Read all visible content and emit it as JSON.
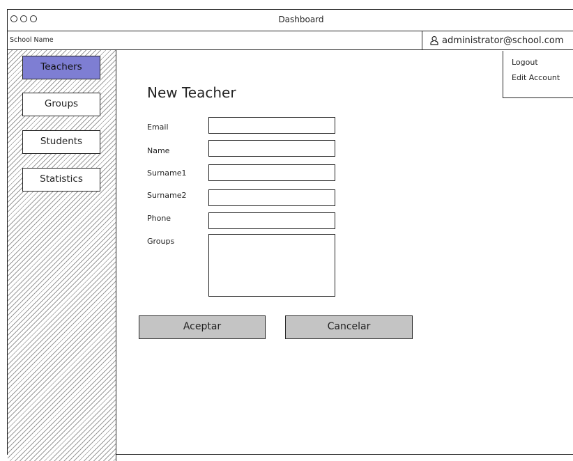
{
  "window": {
    "title": "Dashboard"
  },
  "header": {
    "school_name": "School Name",
    "user_email": "administrator@school.com"
  },
  "user_menu": {
    "items": [
      {
        "label": "Logout"
      },
      {
        "label": "Edit Account"
      }
    ]
  },
  "sidebar": {
    "items": [
      {
        "label": "Teachers",
        "active": true
      },
      {
        "label": "Groups",
        "active": false
      },
      {
        "label": "Students",
        "active": false
      },
      {
        "label": "Statistics",
        "active": false
      }
    ]
  },
  "form": {
    "title": "New Teacher",
    "fields": [
      {
        "label": "Email",
        "value": ""
      },
      {
        "label": "Name",
        "value": ""
      },
      {
        "label": "Surname1",
        "value": ""
      },
      {
        "label": "Surname2",
        "value": ""
      },
      {
        "label": "Phone",
        "value": ""
      },
      {
        "label": "Groups",
        "value": ""
      }
    ],
    "accept_label": "Aceptar",
    "cancel_label": "Cancelar"
  },
  "colors": {
    "active_nav": "#7e7ed3",
    "button_fill": "#c4c4c4",
    "sidebar_hatch": "#9a9a9a"
  },
  "icons": {
    "user": "user-icon"
  }
}
